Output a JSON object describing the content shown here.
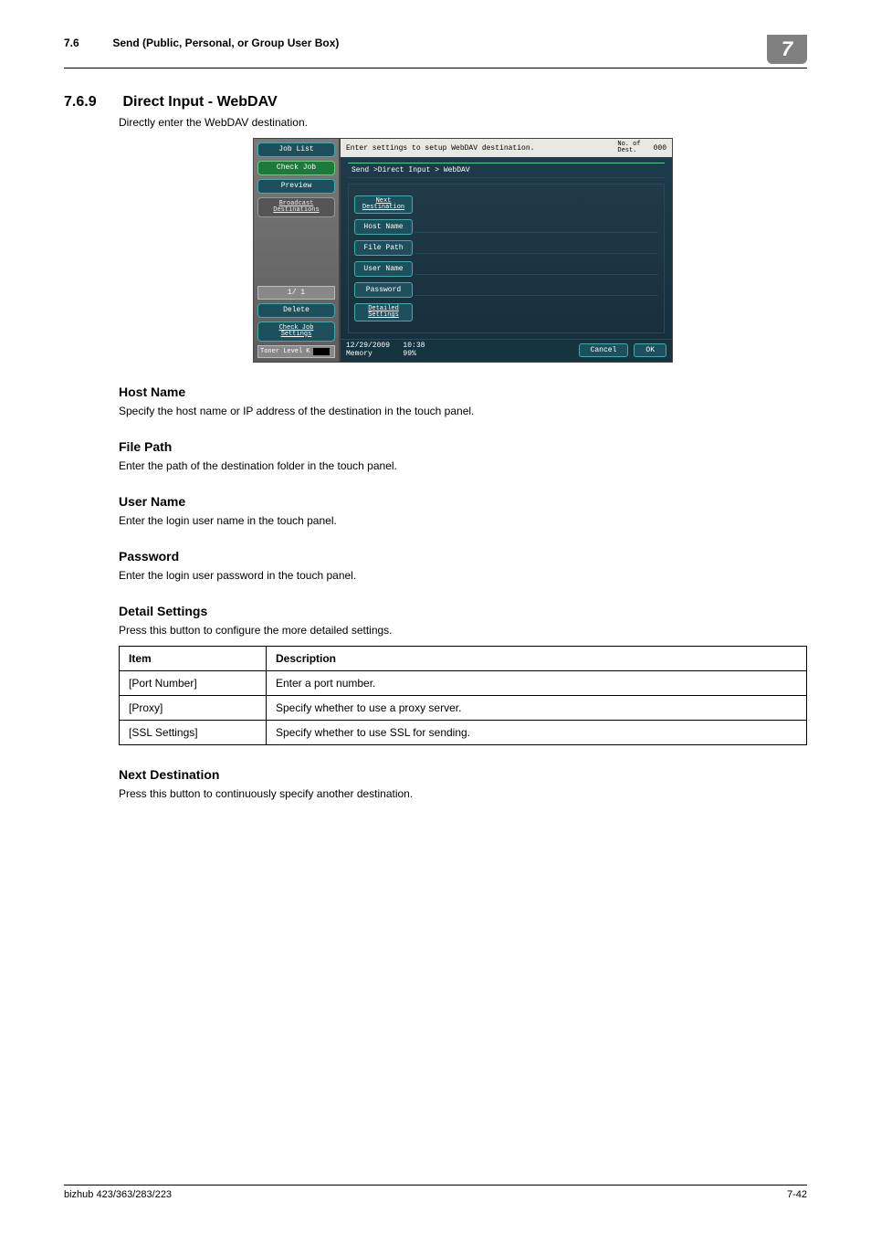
{
  "header": {
    "section_number": "7.6",
    "section_title": "Send (Public, Personal, or Group User Box)",
    "chapter_tab": "7"
  },
  "section": {
    "number": "7.6.9",
    "title": "Direct Input - WebDAV",
    "intro": "Directly enter the WebDAV destination."
  },
  "panel": {
    "left": {
      "job_list": "Job List",
      "check_job": "Check Job",
      "preview": "Preview",
      "broadcast": "Broadcast\nDestinations",
      "page": "1/  1",
      "delete": "Delete",
      "check_settings": "Check Job\nSettings",
      "toner_label": "Toner Level",
      "toner_k": "K"
    },
    "right": {
      "top_msg": "Enter settings to setup WebDAV destination.",
      "dest_label": "No. of\nDest.",
      "dest_count": "000",
      "breadcrumb": "Send >Direct Input > WebDAV",
      "next_dest": "Next\nDestination",
      "host_name": "Host Name",
      "file_path": "File Path",
      "user_name": "User Name",
      "password": "Password",
      "detailed": "Detailed\nSettings",
      "date": "12/29/2009",
      "time": "10:38",
      "mem_label": "Memory",
      "mem_val": "99%",
      "cancel": "Cancel",
      "ok": "OK"
    }
  },
  "subsections": {
    "host_name": {
      "title": "Host Name",
      "text": "Specify the host name or IP address of the destination in the touch panel."
    },
    "file_path": {
      "title": "File Path",
      "text": "Enter the path of the destination folder in the touch panel."
    },
    "user_name": {
      "title": "User Name",
      "text": "Enter the login user name in the touch panel."
    },
    "password": {
      "title": "Password",
      "text": "Enter the login user password in the touch panel."
    },
    "detail_settings": {
      "title": "Detail Settings",
      "text": "Press this button to configure the more detailed settings."
    },
    "next_destination": {
      "title": "Next Destination",
      "text": "Press this button to continuously specify another destination."
    }
  },
  "table": {
    "headers": {
      "item": "Item",
      "description": "Description"
    },
    "rows": [
      {
        "item": "[Port Number]",
        "desc": "Enter a port number."
      },
      {
        "item": "[Proxy]",
        "desc": "Specify whether to use a proxy server."
      },
      {
        "item": "[SSL Settings]",
        "desc": "Specify whether to use SSL for sending."
      }
    ]
  },
  "footer": {
    "left": "bizhub 423/363/283/223",
    "right": "7-42"
  }
}
